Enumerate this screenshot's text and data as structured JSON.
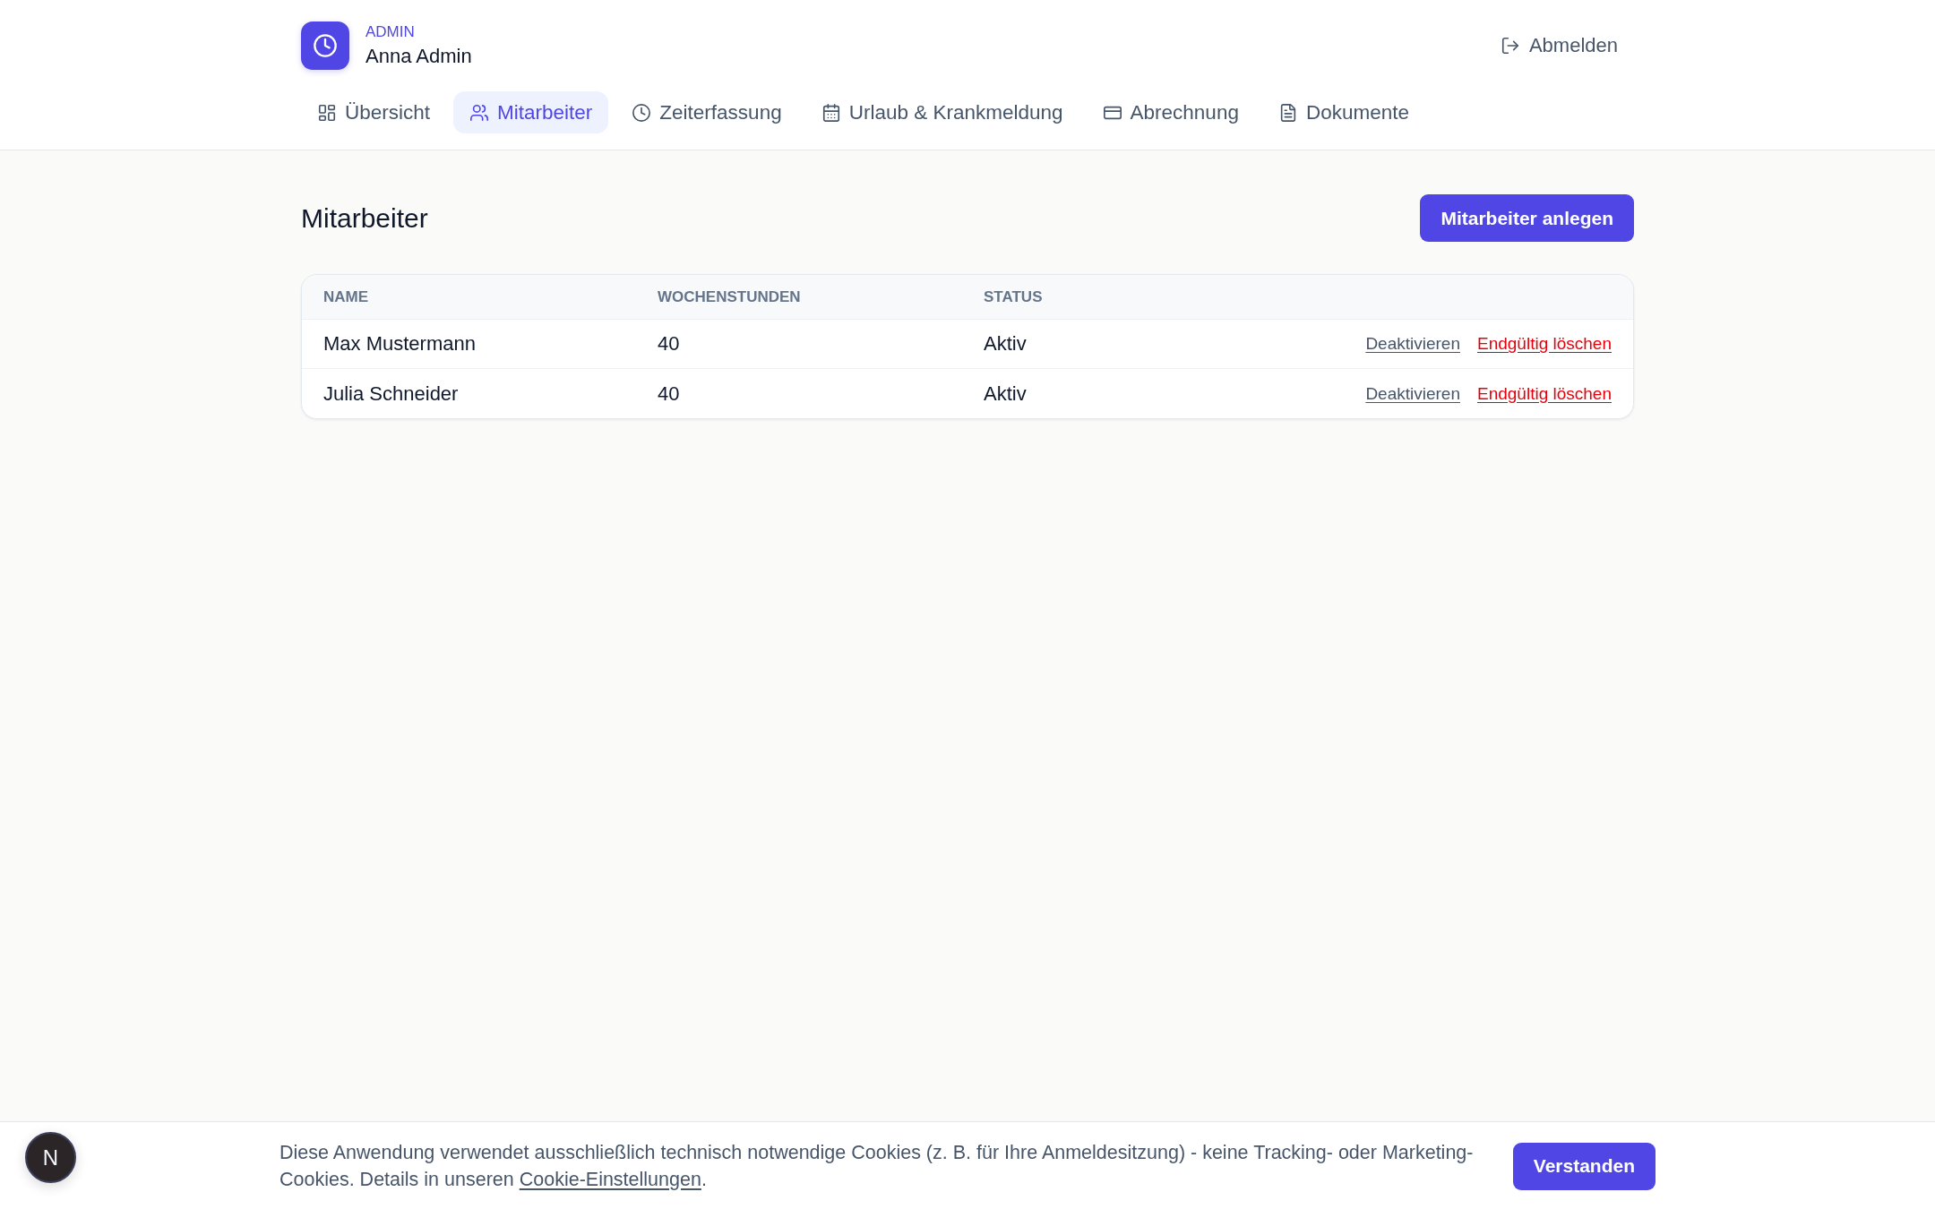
{
  "header": {
    "role": "ADMIN",
    "user_name": "Anna Admin",
    "logout": "Abmelden"
  },
  "nav_tabs": [
    {
      "label": "Übersicht",
      "selected": false
    },
    {
      "label": "Mitarbeiter",
      "selected": true
    },
    {
      "label": "Zeiterfassung",
      "selected": false
    },
    {
      "label": "Urlaub & Krankmeldung",
      "selected": false
    },
    {
      "label": "Abrechnung",
      "selected": false
    },
    {
      "label": "Dokumente",
      "selected": false
    }
  ],
  "page": {
    "title": "Mitarbeiter",
    "create_button": "Mitarbeiter anlegen"
  },
  "table": {
    "columns": [
      "NAME",
      "WOCHENSTUNDEN",
      "STATUS"
    ],
    "rows": [
      {
        "name": "Max Mustermann",
        "weekly_hours": "40",
        "status": "Aktiv",
        "actions": [
          {
            "label": "Deaktivieren",
            "kind": "neutral"
          },
          {
            "label": "Endgültig löschen",
            "kind": "danger"
          }
        ]
      },
      {
        "name": "Julia Schneider",
        "weekly_hours": "40",
        "status": "Aktiv",
        "actions": [
          {
            "label": "Deaktivieren",
            "kind": "neutral"
          },
          {
            "label": "Endgültig löschen",
            "kind": "danger"
          }
        ]
      }
    ]
  },
  "cookie_banner": {
    "text": "Diese Anwendung verwendet ausschließlich technisch notwendige Cookies (z. B. für Ihre Anmeldesitzung) - keine Tracking- oder Marketing-Cookies. Details in unseren ",
    "link": "Cookie-Einstellungen",
    "text_after": ".",
    "button": "Verstanden"
  },
  "dev_badge": {
    "label": "N"
  }
}
